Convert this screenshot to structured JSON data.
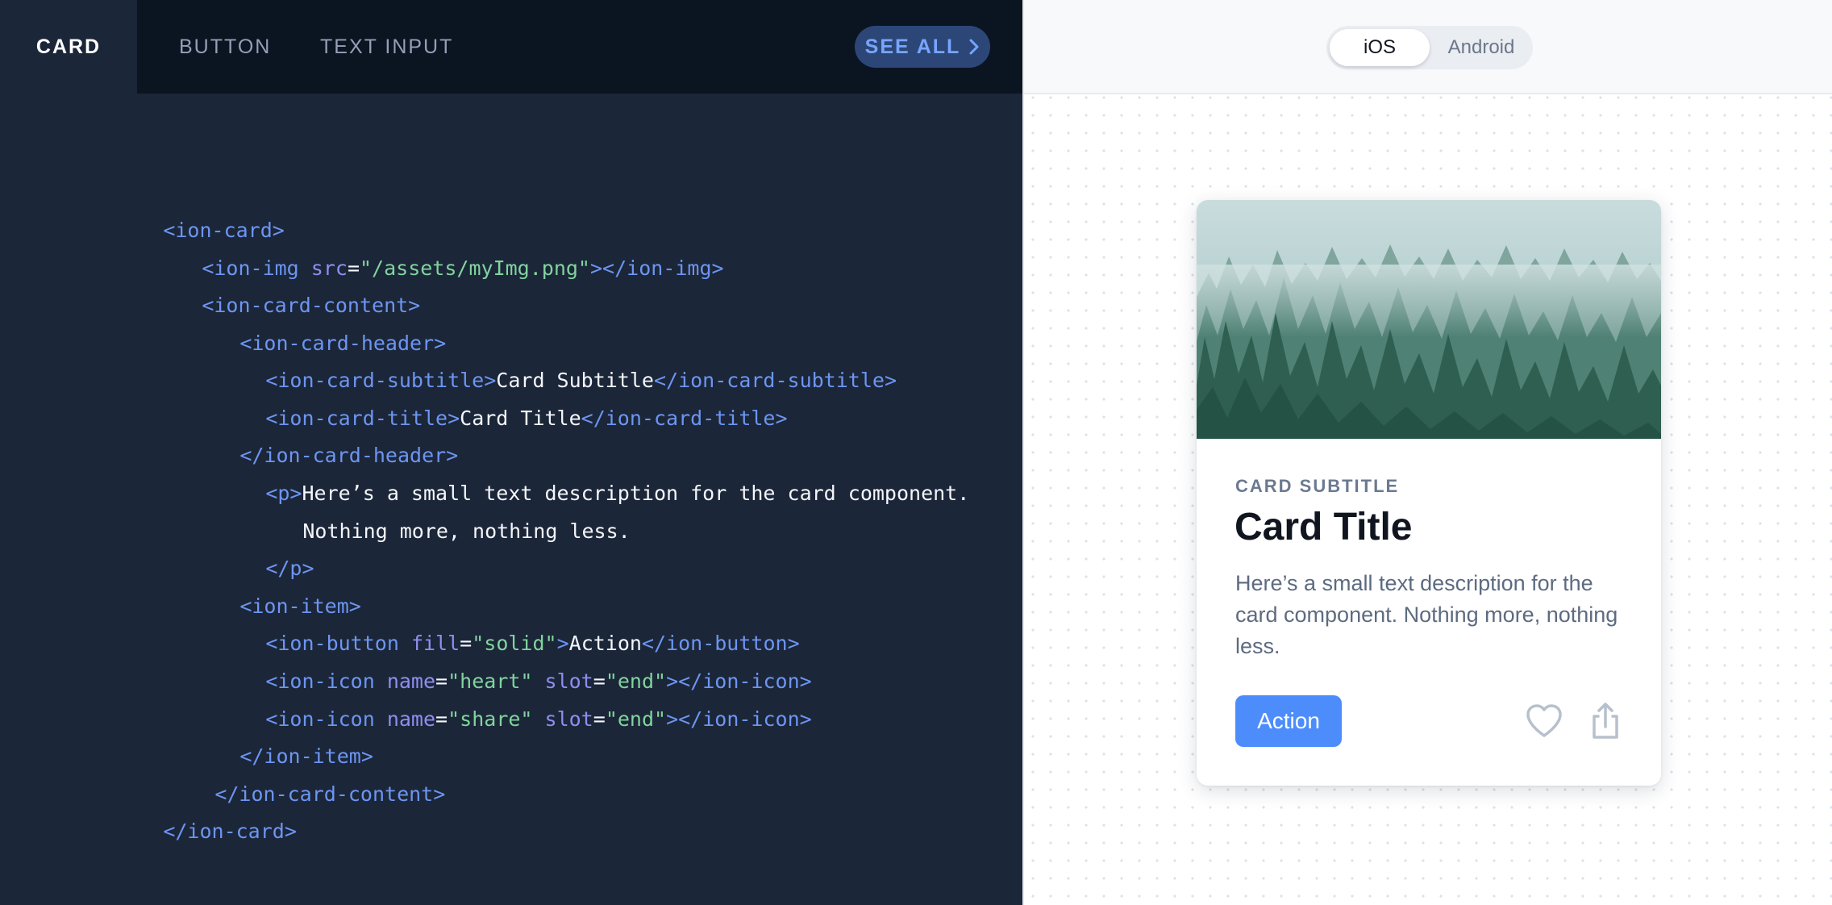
{
  "tabs": [
    {
      "label": "CARD",
      "active": true
    },
    {
      "label": "BUTTON",
      "active": false
    },
    {
      "label": "TEXT INPUT",
      "active": false
    }
  ],
  "see_all": {
    "label": "SEE ALL"
  },
  "code": {
    "l1_open": "<ion-card>",
    "l2_tag": "<ion-img ",
    "l2_attr": "src",
    "l2_eq": "=",
    "l2_str": "\"/assets/myImg.png\"",
    "l2_close": "></ion-img>",
    "l3": "<ion-card-content>",
    "l4": "<ion-card-header>",
    "l5_open": "<ion-card-subtitle>",
    "l5_text": "Card Subtitle",
    "l5_close": "</ion-card-subtitle>",
    "l6_open": "<ion-card-title>",
    "l6_text": "Card Title",
    "l6_close": "</ion-card-title>",
    "l7": "</ion-card-header>",
    "l8_open": "<p>",
    "l8_text": "Here’s a small text description for the card component.",
    "l9_text": "Nothing more, nothing less.",
    "l10": "</p>",
    "l11": "<ion-item>",
    "l12_tag": "<ion-button ",
    "l12_attr": "fill",
    "l12_eq": "=",
    "l12_str": "\"solid\"",
    "l12_gt": ">",
    "l12_text": "Action",
    "l12_close": "</ion-button>",
    "l13_tag": "<ion-icon ",
    "l13_attr1": "name",
    "l13_eq1": "=",
    "l13_str1": "\"heart\" ",
    "l13_attr2": "slot",
    "l13_eq2": "=",
    "l13_str2": "\"end\"",
    "l13_close": "></ion-icon>",
    "l14_tag": "<ion-icon ",
    "l14_attr1": "name",
    "l14_eq1": "=",
    "l14_str1": "\"share\" ",
    "l14_attr2": "slot",
    "l14_eq2": "=",
    "l14_str2": "\"end\"",
    "l14_close": "></ion-icon>",
    "l15": "</ion-item>",
    "l16": "</ion-card-content>",
    "l17": "</ion-card>"
  },
  "platform_toggle": {
    "options": [
      "iOS",
      "Android"
    ],
    "selected": "iOS"
  },
  "card": {
    "image_icon": "misty-forest-image",
    "subtitle": "CARD SUBTITLE",
    "title": "Card Title",
    "description": "Here’s a small text description for the card component. Nothing more, nothing less.",
    "action_label": "Action",
    "icons": [
      "heart-outline-icon",
      "share-icon"
    ]
  },
  "colors": {
    "code_bg": "#1b2638",
    "tabbar_bg": "#0b1421",
    "tag": "#6d95f2",
    "attr": "#8f8ef0",
    "string": "#82d39e",
    "accent": "#4d8dfb"
  }
}
